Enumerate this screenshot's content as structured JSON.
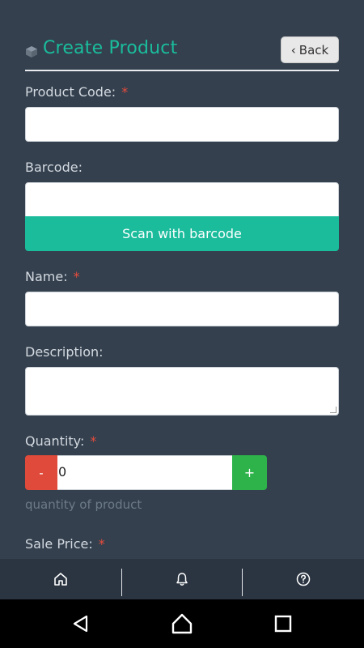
{
  "header": {
    "title": "Create Product",
    "back_label": "Back",
    "icon": "box-icon"
  },
  "form": {
    "product_code": {
      "label": "Product Code:",
      "required_mark": "*",
      "value": ""
    },
    "barcode": {
      "label": "Barcode:",
      "value": "",
      "scan_button": "Scan with barcode"
    },
    "name": {
      "label": "Name:",
      "required_mark": "*",
      "value": ""
    },
    "description": {
      "label": "Description:",
      "value": ""
    },
    "quantity": {
      "label": "Quantity:",
      "required_mark": "*",
      "value": "0",
      "minus_label": "-",
      "plus_label": "+",
      "hint": "quantity of product"
    },
    "sale_price": {
      "label": "Sale Price:",
      "required_mark": "*"
    }
  },
  "tabbar": {
    "items": [
      {
        "icon": "home-icon"
      },
      {
        "icon": "bell-icon"
      },
      {
        "icon": "help-icon"
      }
    ]
  },
  "system_nav": {
    "items": [
      {
        "icon": "back-triangle-icon"
      },
      {
        "icon": "home-circle-icon"
      },
      {
        "icon": "recents-square-icon"
      }
    ]
  },
  "colors": {
    "background": "#34404e",
    "accent": "#1abc9c",
    "required": "#e74c3c",
    "minus": "#e04a3a",
    "plus": "#2db34a"
  }
}
